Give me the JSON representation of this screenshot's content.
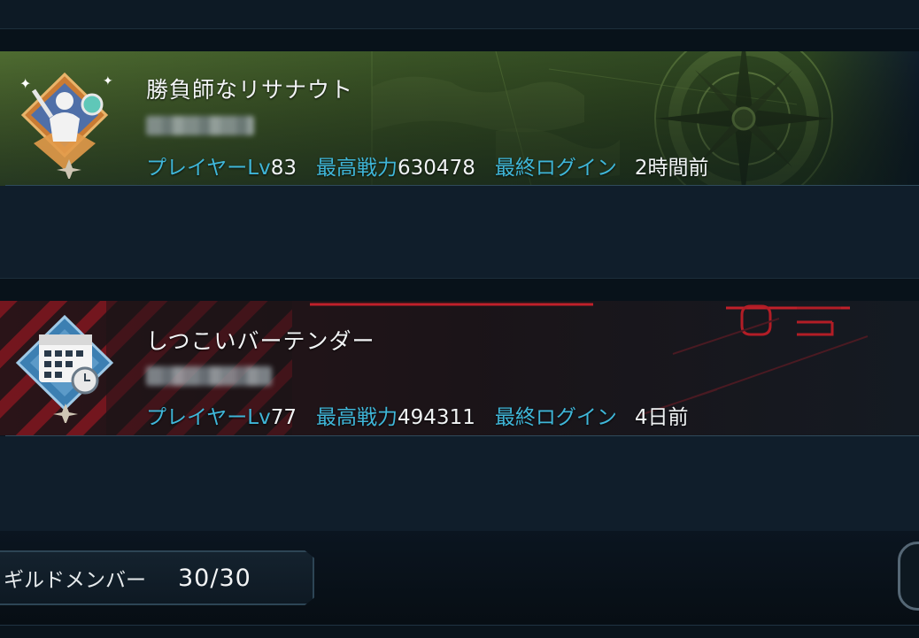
{
  "members": [
    {
      "name": "勝負師なリサナウト",
      "level_label": "プレイヤーLv",
      "level": "83",
      "power_label": "最高戦力",
      "power": "630478",
      "login_label": "最終ログイン",
      "last_login": "2時間前",
      "banner": "green-compass",
      "accent": "#3fb6d8"
    },
    {
      "name": "しつこいバーテンダー",
      "level_label": "プレイヤーLv",
      "level": "77",
      "power_label": "最高戦力",
      "power": "494311",
      "login_label": "最終ログイン",
      "last_login": "4日前",
      "banner": "red-cyber",
      "accent": "#3fb6d8"
    }
  ],
  "footer": {
    "member_label": "ギルドメンバー",
    "member_count": "30/30"
  }
}
